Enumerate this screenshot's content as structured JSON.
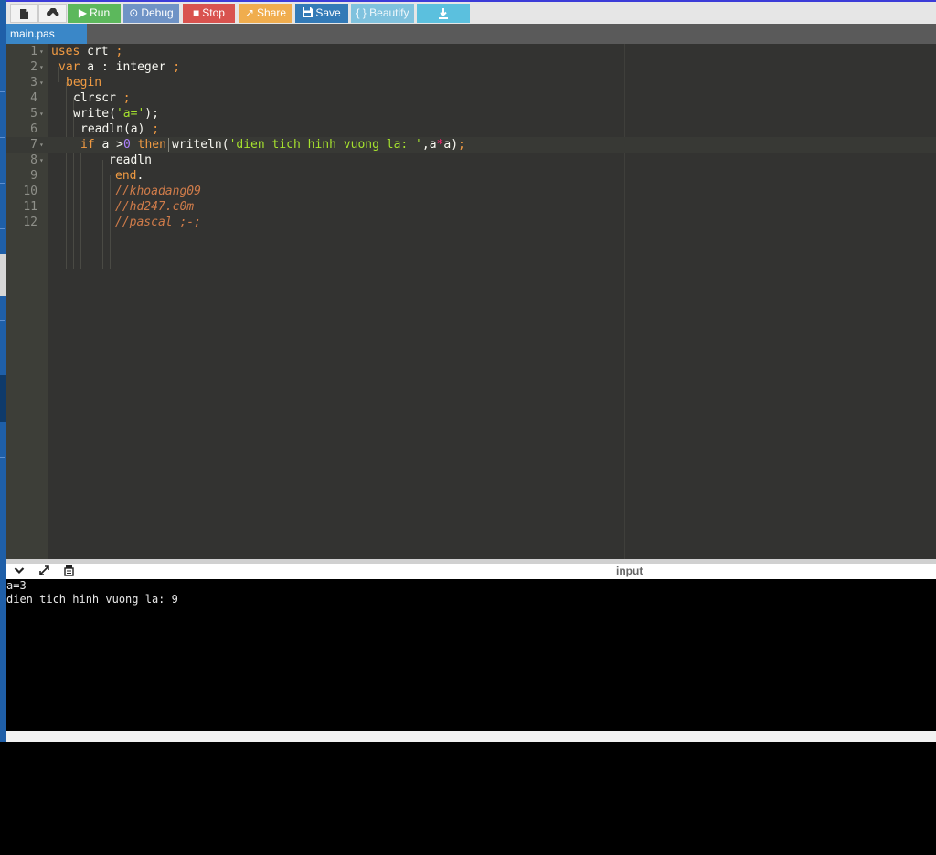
{
  "toolbar": {
    "run_label": "Run",
    "debug_label": "Debug",
    "stop_label": "Stop",
    "share_label": "Share",
    "save_label": "Save",
    "beautify_label": "{ } Beautify"
  },
  "tab": {
    "label": "main.pas"
  },
  "editor": {
    "lines": [
      {
        "num": "1",
        "fold": "▾"
      },
      {
        "num": "2",
        "fold": "▾"
      },
      {
        "num": "3",
        "fold": "▾"
      },
      {
        "num": "4",
        "fold": ""
      },
      {
        "num": "5",
        "fold": "▾"
      },
      {
        "num": "6",
        "fold": ""
      },
      {
        "num": "7",
        "fold": "▾"
      },
      {
        "num": "8",
        "fold": "▾"
      },
      {
        "num": "9",
        "fold": ""
      },
      {
        "num": "10",
        "fold": ""
      },
      {
        "num": "11",
        "fold": ""
      },
      {
        "num": "12",
        "fold": ""
      }
    ],
    "tokens": {
      "l1_kw": "uses",
      "l1_id": " crt ",
      "l1_semi": ";",
      "l2_kw": "var",
      "l2_id": " a : integer ",
      "l2_semi": ";",
      "l3_kw": "begin",
      "l4_id": "clrscr ",
      "l4_semi": ";",
      "l5_id": "write(",
      "l5_str": "'a='",
      "l5_end": ");",
      "l6_id": "readln(a) ",
      "l6_semi": ";",
      "l7_kw1": "if",
      "l7_id": " a ",
      "l7_op": ">",
      "l7_num": "0",
      "l7_kw2": " then",
      "l7_id2": "writeln(",
      "l7_str": "'dien tich hinh vuong la: '",
      "l7_id3": ",a",
      "l7_op2": "*",
      "l7_id4": "a)",
      "l7_semi": ";",
      "l8_id": "readln",
      "l9_kw": "end",
      "l9_dot": ".",
      "l10_cmt": "//khoadang09",
      "l11_cmt": "//hd247.c0m",
      "l12_cmt": "//pascal ;-;"
    }
  },
  "output": {
    "input_label": "input",
    "lines": [
      "a=3",
      "dien tich hinh vuong la: 9"
    ]
  },
  "colors": {
    "run": "#5cb85c",
    "debug": "#6f93c6",
    "stop": "#d9534f",
    "share": "#f0ad4e",
    "save": "#337ab7",
    "beautify": "#7fc2de",
    "download": "#5bc0de",
    "tab": "#3a87c8"
  },
  "icons": {
    "file": "file-icon",
    "upload": "upload-icon",
    "run": "play-icon",
    "debug": "debug-icon",
    "stop": "stop-icon",
    "share": "share-icon",
    "save": "floppy-icon",
    "download": "download-icon",
    "collapse": "chevron-down-icon",
    "expand": "expand-icon",
    "clear": "clear-console-icon"
  }
}
